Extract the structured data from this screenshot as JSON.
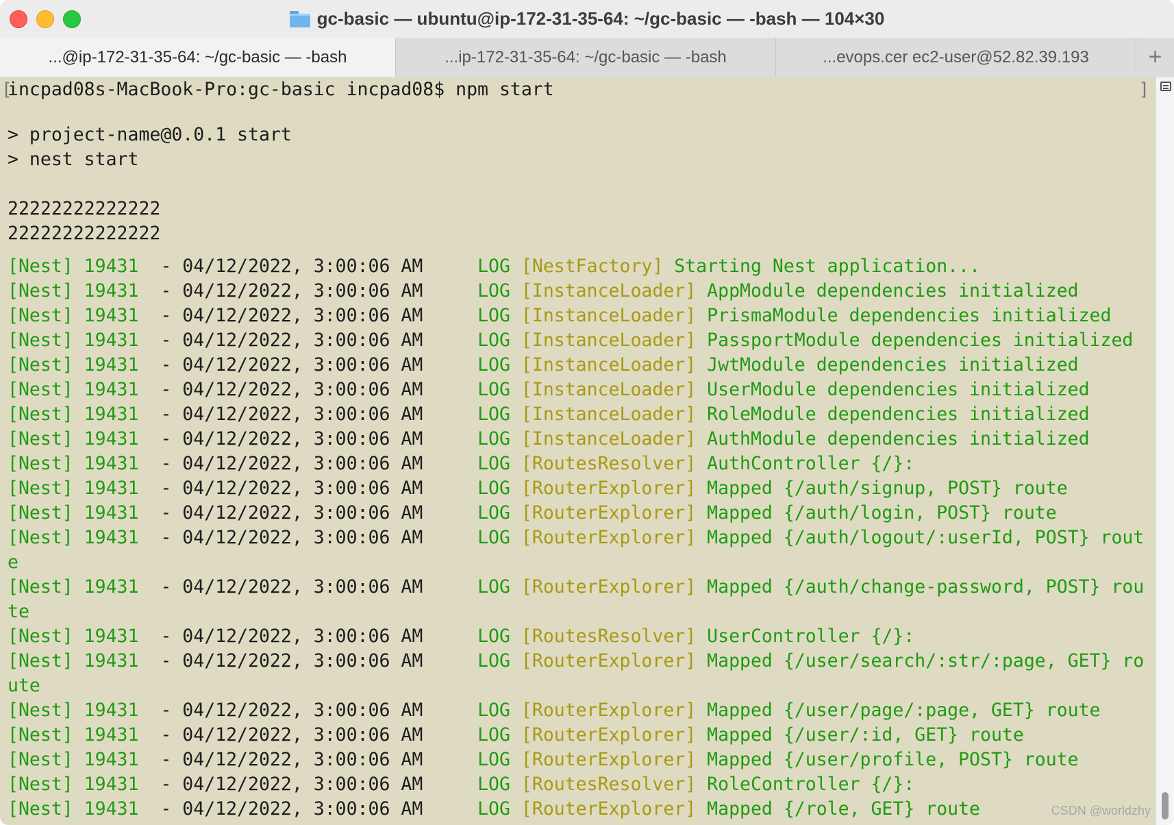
{
  "window": {
    "title": "gc-basic — ubuntu@ip-172-31-35-64: ~/gc-basic — -bash — 104×30"
  },
  "tabs": [
    {
      "label": "...@ip-172-31-35-64: ~/gc-basic — -bash"
    },
    {
      "label": "...ip-172-31-35-64: ~/gc-basic — -bash"
    },
    {
      "label": "...evops.cer ec2-user@52.82.39.193"
    }
  ],
  "new_tab_label": "+",
  "terminal": {
    "prompt": "incpad08s-MacBook-Pro:gc-basic incpad08$ npm start",
    "npm_lines": [
      "> project-name@0.0.1 start",
      "> nest start"
    ],
    "output_lines": [
      "22222222222222",
      "22222222222222"
    ],
    "log_prefix": "[Nest] 19431",
    "log_dash": "- 04/12/2022, 3:00:06 AM",
    "log_level": "LOG",
    "logs": [
      {
        "ctx": "[NestFactory]",
        "msg": "Starting Nest application..."
      },
      {
        "ctx": "[InstanceLoader]",
        "msg": "AppModule dependencies initialized"
      },
      {
        "ctx": "[InstanceLoader]",
        "msg": "PrismaModule dependencies initialized"
      },
      {
        "ctx": "[InstanceLoader]",
        "msg": "PassportModule dependencies initialized"
      },
      {
        "ctx": "[InstanceLoader]",
        "msg": "JwtModule dependencies initialized"
      },
      {
        "ctx": "[InstanceLoader]",
        "msg": "UserModule dependencies initialized"
      },
      {
        "ctx": "[InstanceLoader]",
        "msg": "RoleModule dependencies initialized"
      },
      {
        "ctx": "[InstanceLoader]",
        "msg": "AuthModule dependencies initialized"
      },
      {
        "ctx": "[RoutesResolver]",
        "msg": "AuthController {/}:"
      },
      {
        "ctx": "[RouterExplorer]",
        "msg": "Mapped {/auth/signup, POST} route"
      },
      {
        "ctx": "[RouterExplorer]",
        "msg": "Mapped {/auth/login, POST} route"
      },
      {
        "ctx": "[RouterExplorer]",
        "msg": "Mapped {/auth/logout/:userId, POST} rout",
        "cont": "e"
      },
      {
        "ctx": "[RouterExplorer]",
        "msg": "Mapped {/auth/change-password, POST} rou",
        "cont": "te"
      },
      {
        "ctx": "[RoutesResolver]",
        "msg": "UserController {/}:"
      },
      {
        "ctx": "[RouterExplorer]",
        "msg": "Mapped {/user/search/:str/:page, GET} ro",
        "cont": "ute"
      },
      {
        "ctx": "[RouterExplorer]",
        "msg": "Mapped {/user/page/:page, GET} route"
      },
      {
        "ctx": "[RouterExplorer]",
        "msg": "Mapped {/user/:id, GET} route"
      },
      {
        "ctx": "[RouterExplorer]",
        "msg": "Mapped {/user/profile, POST} route"
      },
      {
        "ctx": "[RoutesResolver]",
        "msg": "RoleController {/}:"
      },
      {
        "ctx": "[RouterExplorer]",
        "msg": "Mapped {/role, GET} route"
      }
    ]
  },
  "colors": {
    "terminal_bg": "#dfdbc3",
    "log_green": "#1f9b12",
    "context_yellow": "#a89913"
  },
  "watermark": "CSDN @worldzhy"
}
